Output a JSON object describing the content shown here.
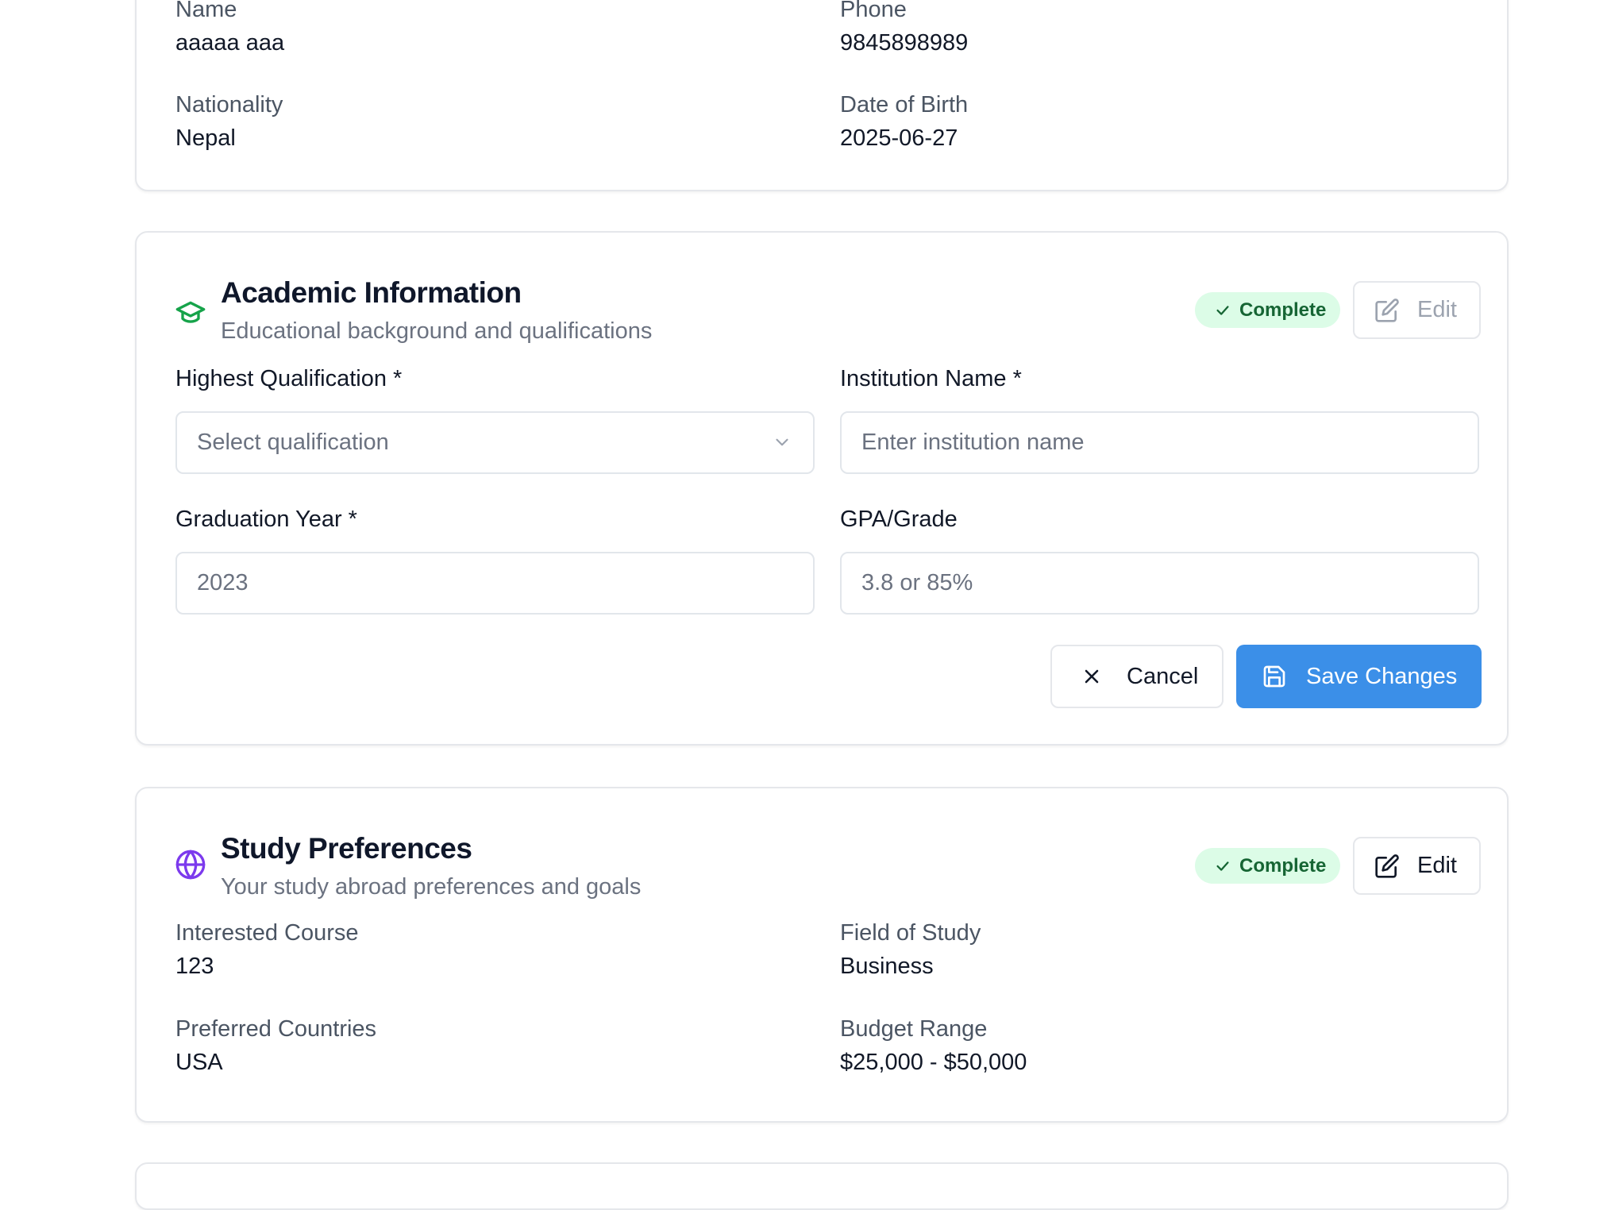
{
  "personal": {
    "name_label": "Name",
    "name_value": "aaaaa aaa",
    "phone_label": "Phone",
    "phone_value": "9845898989",
    "nationality_label": "Nationality",
    "nationality_value": "Nepal",
    "dob_label": "Date of Birth",
    "dob_value": "2025-06-27"
  },
  "academic": {
    "icon": "graduation-cap-icon",
    "icon_color": "#16a34a",
    "title": "Academic Information",
    "subtitle": "Educational background and qualifications",
    "status": "Complete",
    "edit_label": "Edit",
    "qualification_label": "Highest Qualification *",
    "qualification_placeholder": "Select qualification",
    "institution_label": "Institution Name *",
    "institution_placeholder": "Enter institution name",
    "graduation_label": "Graduation Year *",
    "graduation_placeholder": "2023",
    "gpa_label": "GPA/Grade",
    "gpa_placeholder": "3.8 or 85%",
    "cancel_label": "Cancel",
    "save_label": "Save Changes"
  },
  "study": {
    "icon": "globe-icon",
    "icon_color": "#7c3aed",
    "title": "Study Preferences",
    "subtitle": "Your study abroad preferences and goals",
    "status": "Complete",
    "edit_label": "Edit",
    "course_label": "Interested Course",
    "course_value": "123",
    "field_label": "Field of Study",
    "field_value": "Business",
    "countries_label": "Preferred Countries",
    "countries_value": "USA",
    "budget_label": "Budget Range",
    "budget_value": "$25,000 - $50,000"
  },
  "colors": {
    "primary": "#3b8fe8",
    "badge_bg": "#dcfce7",
    "badge_text": "#166534"
  }
}
